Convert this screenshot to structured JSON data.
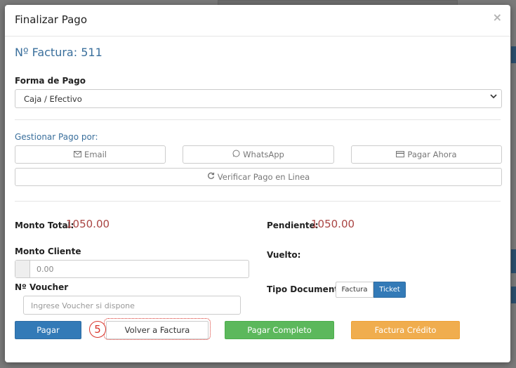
{
  "modal": {
    "title": "Finalizar Pago",
    "close_label": "×"
  },
  "invoice": {
    "title": "Nº Factura: 511"
  },
  "payment_method": {
    "label": "Forma de Pago",
    "selected": "Caja / Efectivo"
  },
  "manage": {
    "label": "Gestionar Pago por:",
    "email_label": "Email",
    "whatsapp_label": "WhatsApp",
    "pay_now_label": "Pagar Ahora",
    "verify_label": "Verificar Pago en Linea"
  },
  "totals": {
    "total_label": "Monto Total:",
    "total_value": "1050.00",
    "pending_label": "Pendiente:",
    "pending_value": "1050.00"
  },
  "client": {
    "amount_label": "Monto Cliente",
    "amount_placeholder": "0.00",
    "change_label": "Vuelto:"
  },
  "voucher": {
    "label": "Nº Voucher",
    "placeholder": "Ingrese Voucher si dispone"
  },
  "doc_type": {
    "label": "Tipo Documento",
    "options": [
      "Factura",
      "Ticket"
    ],
    "selected": "Ticket"
  },
  "actions": {
    "pay_label": "Pagar",
    "back_label": "Volver a Factura",
    "pay_full_label": "Pagar Completo",
    "credit_label": "Factura Crédito"
  },
  "annotation": {
    "step": "5"
  },
  "icons": {
    "email": "envelope-icon",
    "whatsapp": "whatsapp-icon",
    "pay_now": "credit-card-icon",
    "verify": "refresh-icon",
    "select": "chevron-down-icon"
  },
  "colors": {
    "primary": "#337ab7",
    "success": "#5cb85c",
    "warning": "#f0ad4e",
    "amount": "#a94442",
    "link": "#3a6f9c",
    "annotation": "#d9342b"
  }
}
